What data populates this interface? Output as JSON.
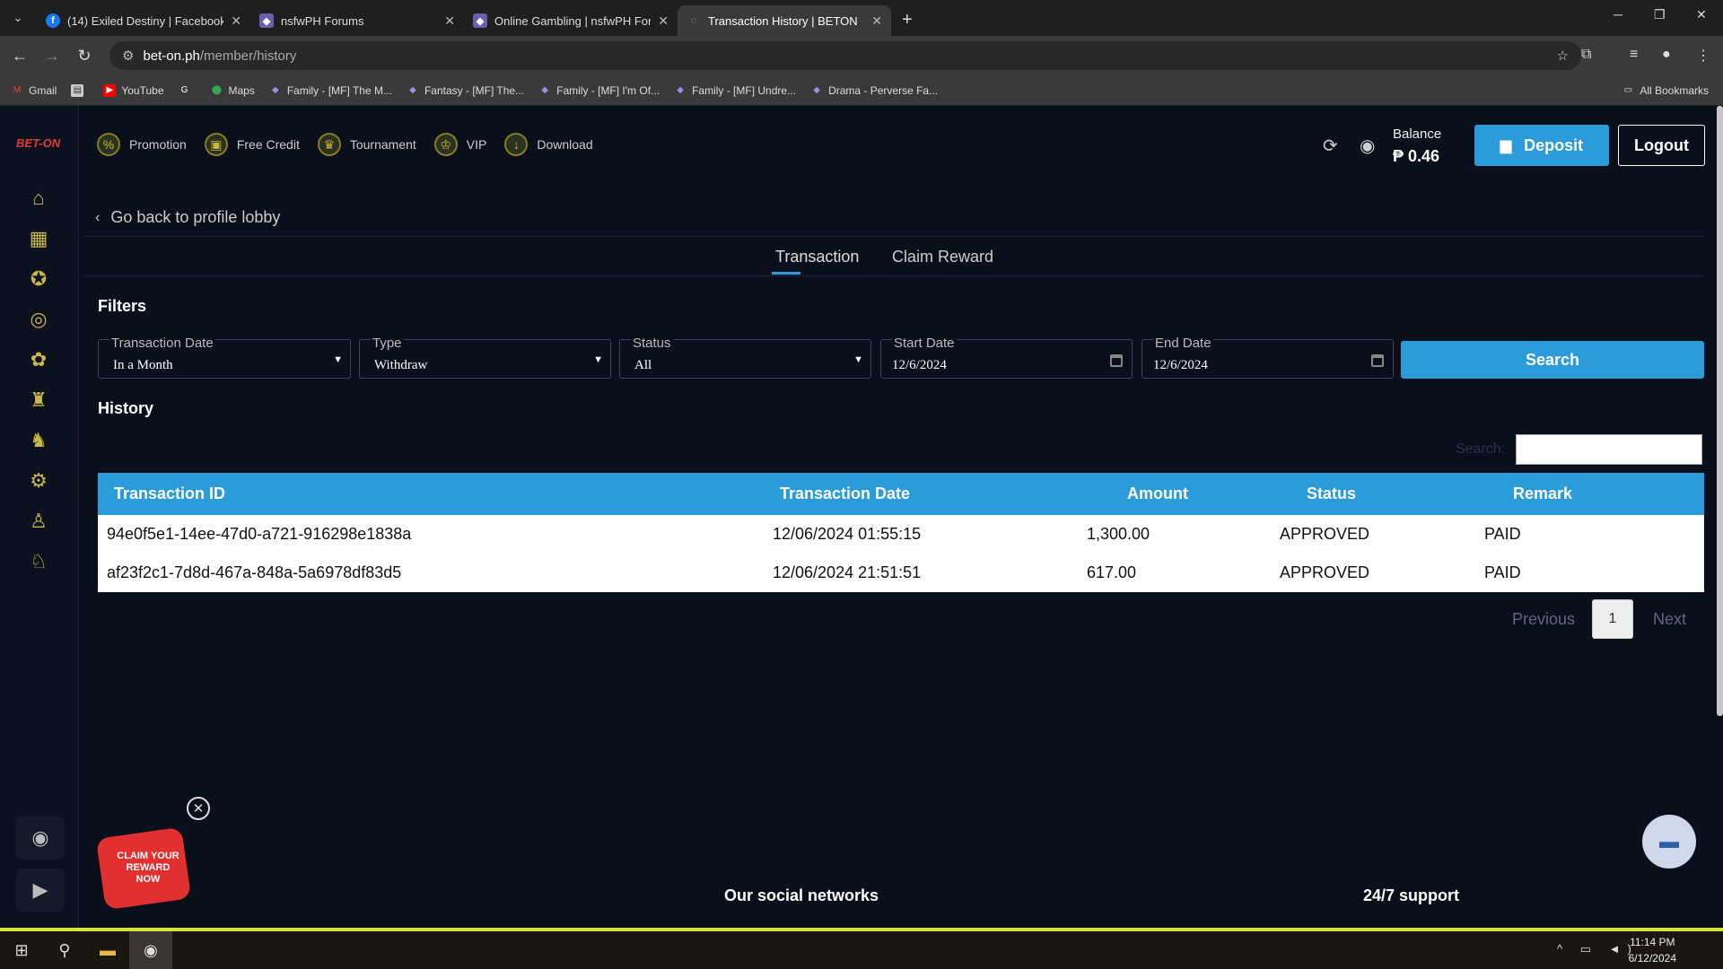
{
  "browser": {
    "tabs": [
      {
        "title": "(14) Exiled Destiny | Facebook",
        "icon": "facebook-icon"
      },
      {
        "title": "nsfwPH Forums",
        "icon": "nsfwph-icon"
      },
      {
        "title": "Online Gambling | nsfwPH Foru",
        "icon": "nsfwph-icon"
      },
      {
        "title": "Transaction History | BETON",
        "icon": "globe-icon"
      }
    ],
    "url_host": "bet-on.ph",
    "url_path": "/member/history",
    "bookmarks": [
      "Gmail",
      "YouTube",
      "Maps",
      "Family - [MF] The M...",
      "Fantasy - [MF] The...",
      "Family - [MF] I'm Of...",
      "Family - [MF] Undre...",
      "Drama - Perverse Fa..."
    ],
    "all_bookmarks": "All Bookmarks"
  },
  "site": {
    "logo_text": "BET-ON",
    "nav": [
      "Promotion",
      "Free Credit",
      "Tournament",
      "VIP",
      "Download"
    ],
    "balance_label": "Balance",
    "balance_value": "₱ 0.46",
    "deposit_label": "Deposit",
    "logout_label": "Logout",
    "back_label": "Go back to profile lobby",
    "tabs": [
      "Transaction",
      "Claim Reward"
    ],
    "filters_title": "Filters",
    "filters": {
      "transaction_date": {
        "label": "Transaction Date",
        "value": "In a Month"
      },
      "type": {
        "label": "Type",
        "value": "Withdraw"
      },
      "status": {
        "label": "Status",
        "value": "All"
      },
      "start_date": {
        "label": "Start Date",
        "value": "12/6/2024"
      },
      "end_date": {
        "label": "End Date",
        "value": "12/6/2024"
      }
    },
    "search_button": "Search",
    "history_title": "History",
    "table_search_label": "Search:",
    "table": {
      "headers": [
        "Transaction ID",
        "Transaction Date",
        "Amount",
        "Status",
        "Remark"
      ],
      "rows": [
        [
          "94e0f5e1-14ee-47d0-a721-916298e1838a",
          "12/06/2024 01:55:15",
          "1,300.00",
          "APPROVED",
          "PAID"
        ],
        [
          "af23f2c1-7d8d-467a-848a-5a6978df83d5",
          "12/06/2024 21:51:51",
          "617.00",
          "APPROVED",
          "PAID"
        ]
      ]
    },
    "pagination": {
      "previous": "Previous",
      "current": "1",
      "next": "Next"
    },
    "promo_text": "CLAIM YOUR REWARD NOW",
    "footer_social": "Our social networks",
    "footer_support": "24/7 support"
  },
  "taskbar": {
    "time": "11:14 PM",
    "date": "6/12/2024"
  },
  "colors": {
    "accent": "#2b9bd9",
    "background": "#0a0f1c",
    "gold": "#c9b53a"
  }
}
